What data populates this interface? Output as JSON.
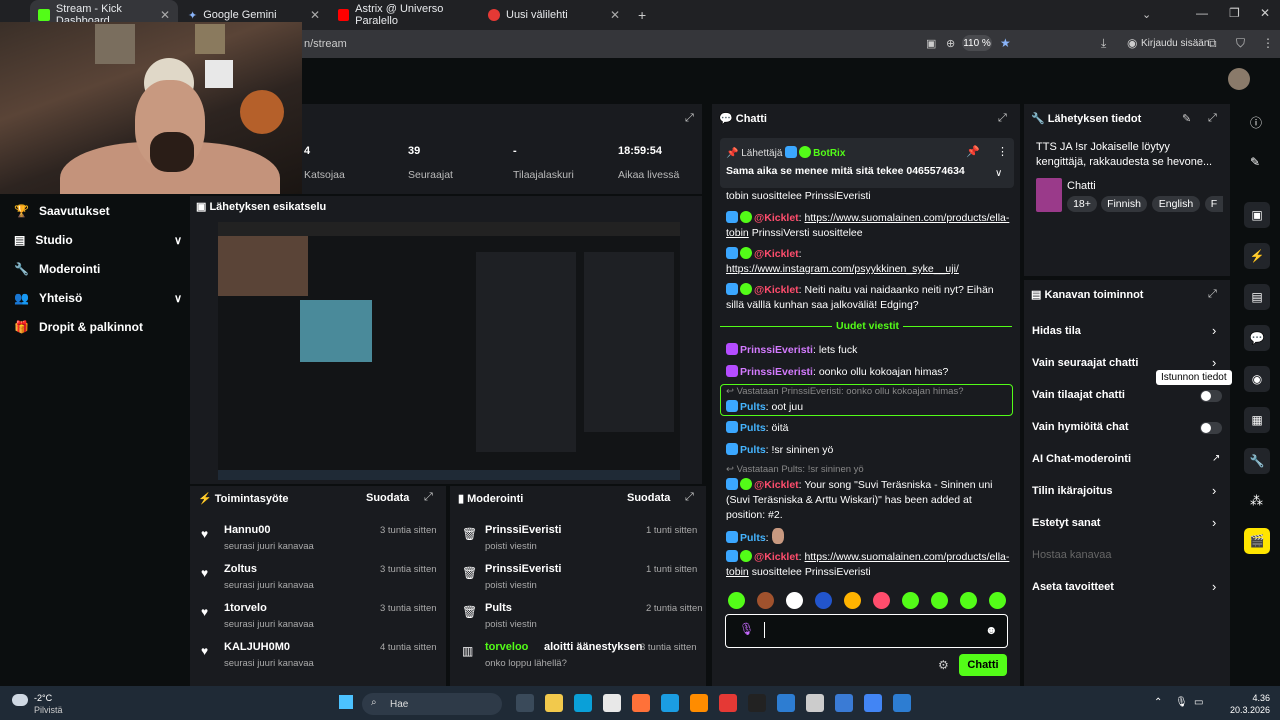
{
  "browser": {
    "tabs": [
      {
        "label": "Stream - Kick Dashboard"
      },
      {
        "label": "Google Gemini"
      },
      {
        "label": "Astrix @ Universo Paralello"
      },
      {
        "label": "Uusi välilehti"
      }
    ],
    "url": "n/stream",
    "zoom": "110 %",
    "signin": "Kirjaudu sisään"
  },
  "stats": [
    {
      "value": "4",
      "label": "Katsojaa"
    },
    {
      "value": "39",
      "label": "Seuraajat"
    },
    {
      "value": "-",
      "label": "Tilaajalaskuri"
    },
    {
      "value": "18:59:54",
      "label": "Aikaa livessä"
    }
  ],
  "sidebar": {
    "items": [
      {
        "label": "Saavutukset"
      },
      {
        "label": "Studio"
      },
      {
        "label": "Moderointi"
      },
      {
        "label": "Yhteisö"
      },
      {
        "label": "Dropit & palkinnot"
      }
    ]
  },
  "preview": {
    "title": "Lähetyksen esikatselu"
  },
  "activity": {
    "title": "Toimintasyöte",
    "filter": "Suodata",
    "rows": [
      {
        "name": "Hannu00",
        "sub": "seurasi juuri kanavaa",
        "time": "3 tuntia sitten"
      },
      {
        "name": "Zoltus",
        "sub": "seurasi juuri kanavaa",
        "time": "3 tuntia sitten"
      },
      {
        "name": "1torvelo",
        "sub": "seurasi juuri kanavaa",
        "time": "3 tuntia sitten"
      },
      {
        "name": "KALJUH0M0",
        "sub": "seurasi juuri kanavaa",
        "time": "4 tuntia sitten"
      }
    ]
  },
  "moderation": {
    "title": "Moderointi",
    "filter": "Suodata",
    "rows": [
      {
        "name": "PrinssiEveristi",
        "sub": "poisti viestin",
        "time": "1 tunti sitten"
      },
      {
        "name": "PrinssiEveristi",
        "sub": "poisti viestin",
        "time": "1 tunti sitten"
      },
      {
        "name": "Pults",
        "sub": "poisti viestin",
        "time": "2 tuntia sitten"
      },
      {
        "name": "torveloo",
        "action": "aloitti äänestyksen",
        "sub": "onko loppu lähellä?",
        "time": "3 tuntia sitten"
      }
    ]
  },
  "chat": {
    "title": "Chatti",
    "pinned": {
      "sender_label": "Lähettäjä",
      "sender": "BotRix",
      "text": "Sama aika se menee mitä sitä tekee 0465574634"
    },
    "top_fragment": "tobin suosittelee PrinssiEveristi",
    "messages": [
      {
        "user": "@Kicklet",
        "link": "https://www.suomalainen.com/products/ella-tobin",
        "text": " PrinssiVersti suosittelee"
      },
      {
        "user": "@Kicklet",
        "link": "https://www.instagram.com/psyykkinen_syke__uji/",
        "text": ""
      },
      {
        "user": "@Kicklet",
        "text": "Neiti naitu vai naidaanko neiti nyt? Eihän sillä välllä kunhan saa jalkoväliä! Edging?"
      }
    ],
    "new_label": "Uudet viestit",
    "new_messages": [
      {
        "user": "PrinssiEveristi",
        "text": "lets fuck"
      },
      {
        "user": "PrinssiEveristi",
        "text": "oonko ollu kokoajan himas?"
      },
      {
        "reply": "Vastataan PrinssiEveristi: oonko ollu kokoajan himas?",
        "user": "Pults",
        "text": "oot juu"
      },
      {
        "user": "Pults",
        "text": "öitä"
      },
      {
        "user": "Pults",
        "text": "!sr sininen yö"
      },
      {
        "reply": "Vastataan Pults: !sr sininen yö",
        "user": "@Kicklet",
        "text": "Your song \"Suvi Teräsniska - Sininen uni (Suvi Teräsniska & Arttu Wiskari)\" has been added at position: #2."
      },
      {
        "user": "Pults",
        "text": ""
      },
      {
        "user": "@Kicklet",
        "link": "https://www.suomalainen.com/products/ella-tobin",
        "text": " suosittelee PrinssiEveristi"
      }
    ],
    "send": "Chatti"
  },
  "stream_info": {
    "title": "Lähetyksen tiedot",
    "text": "TTS JA !sr Jokaiselle löytyy kengittäjä, rakkaudesta se hevone...",
    "category": "Chatti",
    "tags": [
      "18+",
      "Finnish",
      "English",
      "F"
    ]
  },
  "channel_actions": {
    "title": "Kanavan toiminnot",
    "items": [
      {
        "label": "Hidas tila",
        "type": "arrow"
      },
      {
        "label": "Vain seuraajat chatti",
        "type": "arrow"
      },
      {
        "label": "Vain tilaajat chatti",
        "type": "toggle"
      },
      {
        "label": "Vain hymiöitä chat",
        "type": "toggle"
      },
      {
        "label": "AI Chat-moderointi",
        "type": "ext"
      },
      {
        "label": "Tilin ikärajoitus",
        "type": "arrow"
      },
      {
        "label": "Estetyt sanat",
        "type": "arrow"
      },
      {
        "label": "Hostaa kanavaa",
        "type": "disabled"
      },
      {
        "label": "Aseta tavoitteet",
        "type": "arrow"
      }
    ]
  },
  "tooltip": "Istunnon tiedot",
  "taskbar": {
    "weather_temp": "-2°C",
    "weather_text": "Pilvistä",
    "search": "Hae",
    "time": "4.36",
    "date": "20.3.2026"
  },
  "colors": {
    "accent": "#53fc18",
    "bg": "#0b0e0f",
    "panel": "#191b1f"
  }
}
